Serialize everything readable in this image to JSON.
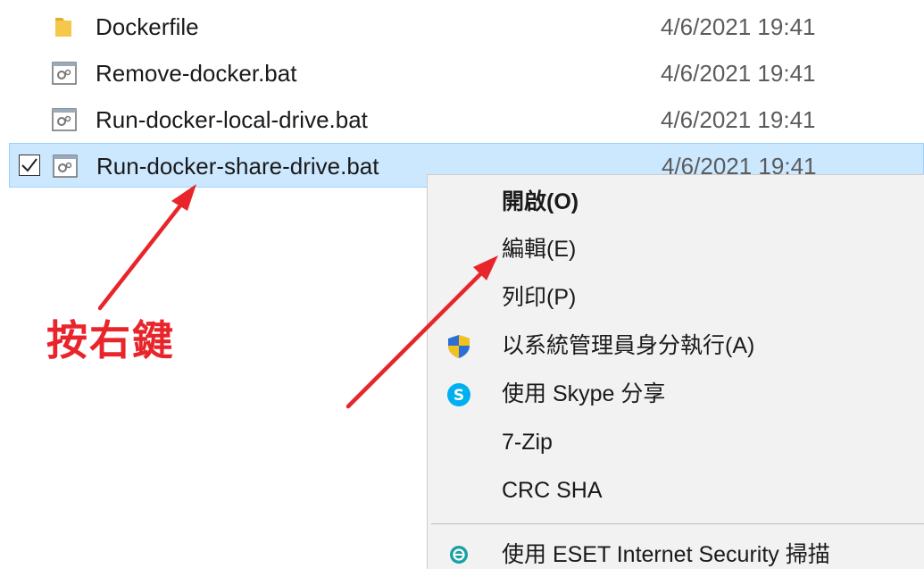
{
  "files": [
    {
      "name": "Dockerfile",
      "date": "4/6/2021 19:41",
      "icon": "folder-icon",
      "selected": false
    },
    {
      "name": "Remove-docker.bat",
      "date": "4/6/2021 19:41",
      "icon": "batch-file-icon",
      "selected": false
    },
    {
      "name": "Run-docker-local-drive.bat",
      "date": "4/6/2021 19:41",
      "icon": "batch-file-icon",
      "selected": false
    },
    {
      "name": "Run-docker-share-drive.bat",
      "date": "4/6/2021 19:41",
      "icon": "batch-file-icon",
      "selected": true
    }
  ],
  "context_menu": {
    "items": [
      {
        "label": "開啟(O)",
        "bold": true,
        "icon": null
      },
      {
        "label": "編輯(E)",
        "bold": false,
        "icon": null
      },
      {
        "label": "列印(P)",
        "bold": false,
        "icon": null
      },
      {
        "label": "以系統管理員身分執行(A)",
        "bold": false,
        "icon": "uac-shield-icon"
      },
      {
        "label": "使用 Skype 分享",
        "bold": false,
        "icon": "skype-icon"
      },
      {
        "label": "7-Zip",
        "bold": false,
        "icon": null
      },
      {
        "label": "CRC SHA",
        "bold": false,
        "icon": null
      },
      {
        "label": "使用 ESET Internet Security 掃描",
        "bold": false,
        "icon": "eset-icon"
      }
    ]
  },
  "annotation": {
    "text": "按右鍵",
    "color": "#e8252b"
  },
  "colors": {
    "selection_bg": "#cce8ff",
    "selection_border": "#99d1ff",
    "menu_bg": "#f2f2f2",
    "skype_blue": "#00aff0",
    "eset_teal": "#1aa1a3",
    "folder_yellow": "#f5c84c"
  }
}
